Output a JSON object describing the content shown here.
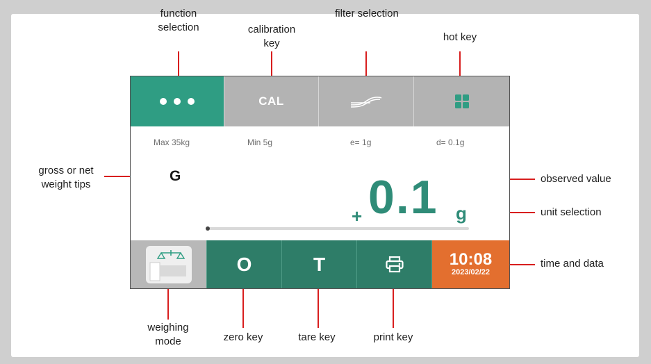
{
  "screen": {
    "top_bar": {
      "cal_label": "CAL"
    },
    "specs": {
      "max": "Max 35kg",
      "min": "Min 5g",
      "e": "e= 1g",
      "d": "d= 0.1g"
    },
    "gross_net_mark": "G",
    "reading": {
      "sign": "+",
      "value": "0.1",
      "unit": "g"
    },
    "progress_fraction": 0.0,
    "bottom_bar": {
      "zero_label": "O",
      "tare_label": "T",
      "time": "10:08",
      "date": "2023/02/22"
    }
  },
  "callouts": {
    "function_selection": "function selection",
    "calibration_key": "calibration key",
    "filter_selection": "filter selection",
    "hot_key": "hot key",
    "gross_net": "gross or net weight tips",
    "observed_value": "observed value",
    "unit_selection": "unit selection",
    "time_and_data": "time and data",
    "weighing_mode": "weighing mode",
    "zero_key": "zero key",
    "tare_key": "tare key",
    "print_key": "print key"
  },
  "colors": {
    "teal": "#2f9d83",
    "dark_teal": "#2e7d68",
    "orange": "#e36f2f",
    "gray": "#b3b3b3",
    "callout_line": "#d81e1e"
  },
  "icons": [
    "dots-icon",
    "filter-wave-icon",
    "grid-icon",
    "scale-icon",
    "printer-icon"
  ]
}
